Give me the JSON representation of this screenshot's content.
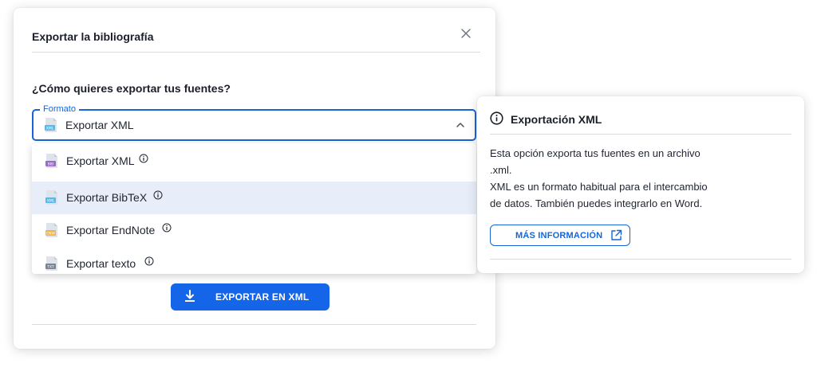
{
  "modal": {
    "title": "Exportar la bibliografía",
    "question": "¿Cómo quieres exportar tus fuentes?",
    "format_label": "Formato",
    "selected_value": "Exportar XML",
    "selected_file_tag": "XML",
    "export_button": "EXPORTAR EN XML"
  },
  "dropdown": {
    "items": [
      {
        "label": "Exportar XML",
        "file_tag": "BIB",
        "color": "#9b6bc9"
      },
      {
        "label": "Exportar BibTeX",
        "file_tag": "XML",
        "color": "#5bb8e8",
        "highlighted": true
      },
      {
        "label": "Exportar EndNote",
        "file_tag": "ENW",
        "color": "#f2b24d"
      },
      {
        "label": "Exportar texto",
        "file_tag": "TXT",
        "color": "#7b8594"
      }
    ]
  },
  "panel": {
    "title": "Exportación XML",
    "line1": "Esta opción exporta tus fuentes en un archivo",
    "line2": ".xml.",
    "line3": "XML es un formato habitual para el intercambio",
    "line4": "de datos. También puedes integrarlo en Word.",
    "more_button": "MÁS INFORMACIÓN"
  },
  "colors": {
    "accent": "#1565d8",
    "button": "#1565e8",
    "highlight": "#e8eef9"
  }
}
